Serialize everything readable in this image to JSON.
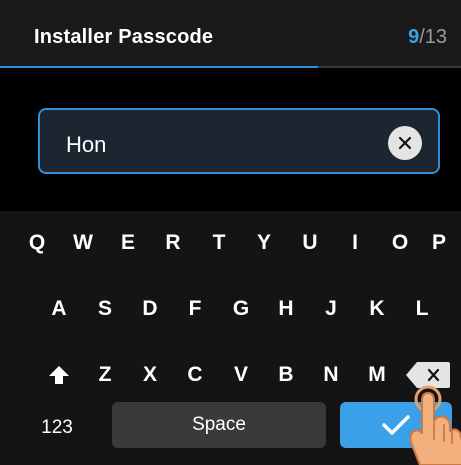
{
  "header": {
    "title": "Installer Passcode",
    "step_current": "9",
    "step_total": "/13",
    "progress": 0.69
  },
  "input": {
    "value": "Hon"
  },
  "keyboard": {
    "row1": [
      "Q",
      "W",
      "E",
      "R",
      "T",
      "Y",
      "U",
      "I",
      "O",
      "P"
    ],
    "row2": [
      "A",
      "S",
      "D",
      "F",
      "G",
      "H",
      "J",
      "K",
      "L"
    ],
    "row3": [
      "Z",
      "X",
      "C",
      "V",
      "B",
      "N",
      "M"
    ],
    "mode_label": "123",
    "space_label": "Space"
  },
  "colors": {
    "accent": "#3aa0e8",
    "background": "#000000",
    "keyboard_bg": "#141414"
  },
  "icons": {
    "clear": "close-icon",
    "shift": "shift-arrow-icon",
    "backspace": "backspace-icon",
    "done": "checkmark-icon",
    "pointer": "hand-pointer-icon"
  }
}
